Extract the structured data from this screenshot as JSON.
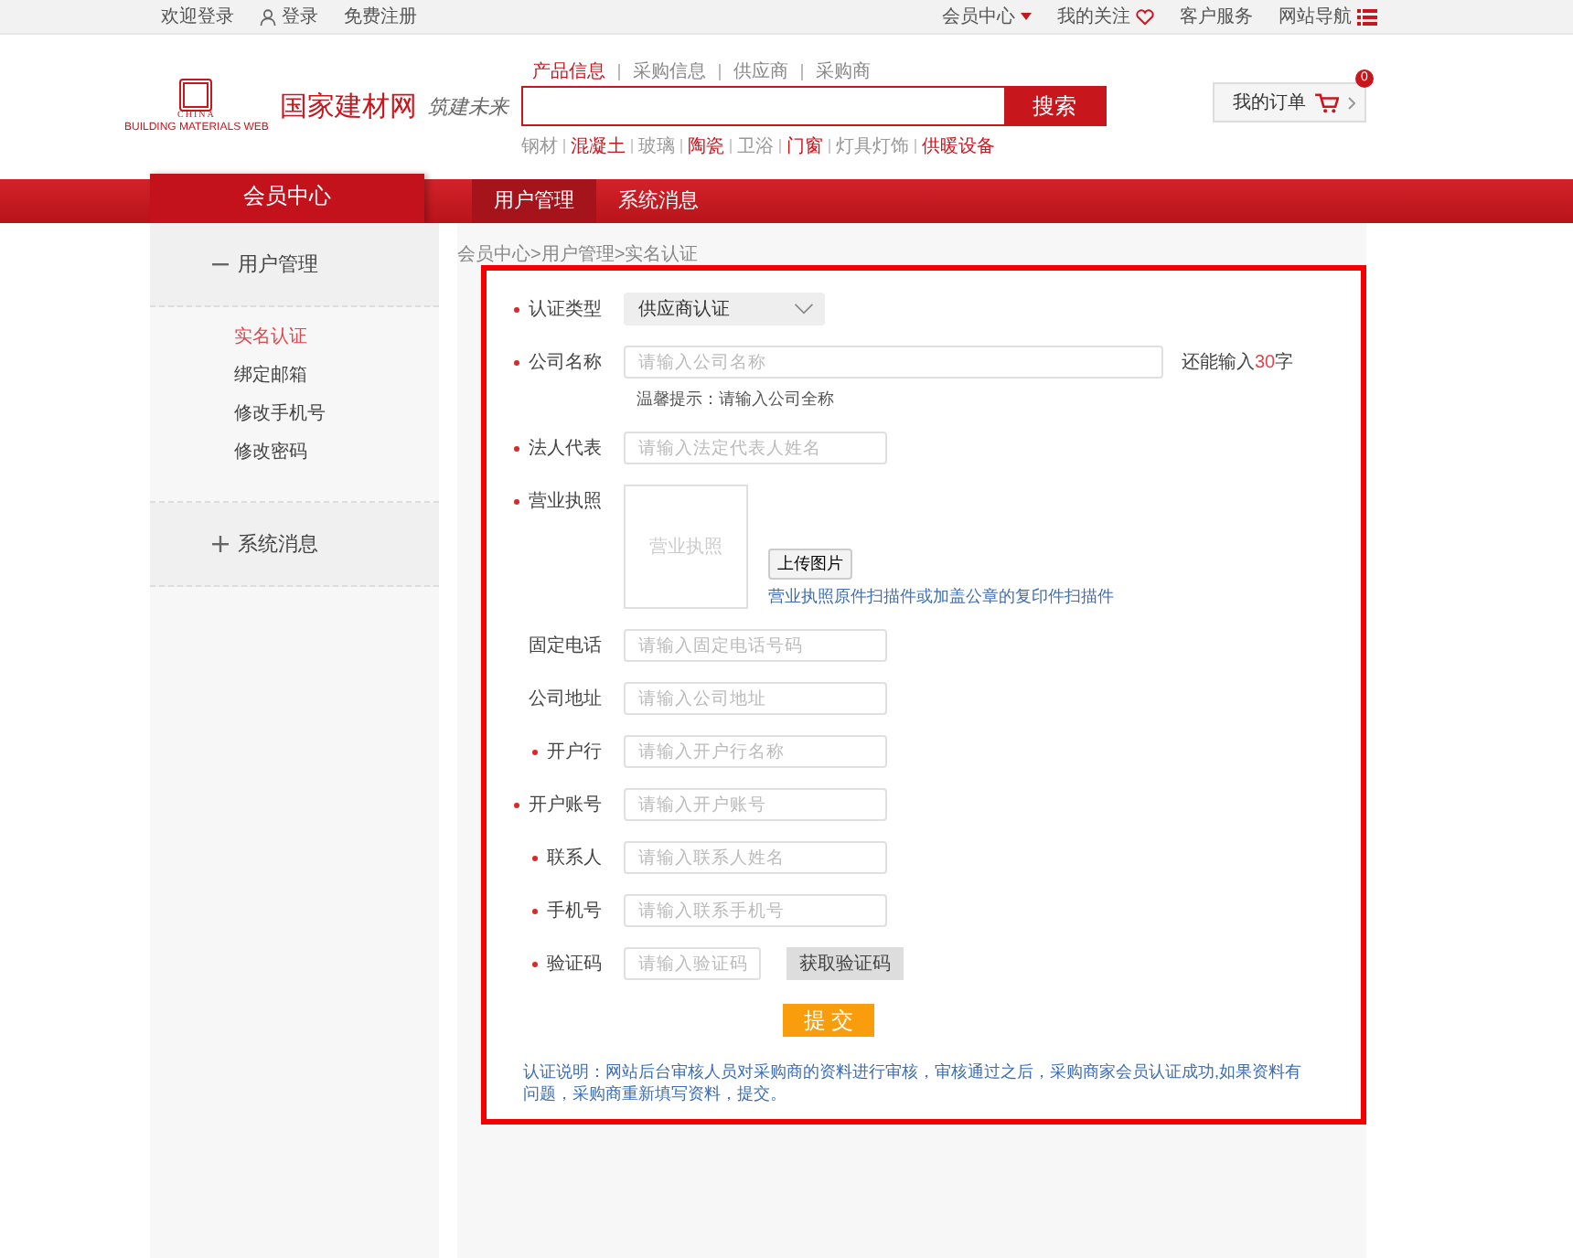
{
  "top_bar": {
    "left": [
      {
        "kind": "text",
        "label": "欢迎登录"
      },
      {
        "kind": "user",
        "label": "登录"
      },
      {
        "kind": "text",
        "label": "免费注册"
      }
    ],
    "right": [
      {
        "kind": "dropdown",
        "label": "会员中心"
      },
      {
        "kind": "heart",
        "label": "我的关注"
      },
      {
        "kind": "text",
        "label": "客户服务"
      },
      {
        "kind": "list",
        "label": "网站导航"
      }
    ]
  },
  "header": {
    "logo_sub": "CHINA",
    "logo_small": "BUILDING MATERIALS WEB",
    "site_name": "国家建材网",
    "slogan": "筑建未来",
    "search_tabs": [
      {
        "label": "产品信息",
        "selected": true
      },
      {
        "label": "采购信息",
        "selected": false
      },
      {
        "label": "供应商",
        "selected": false
      },
      {
        "label": "采购商",
        "selected": false
      }
    ],
    "search_button": "搜索",
    "hot_words": [
      {
        "label": "钢材",
        "highlight": false
      },
      {
        "label": "混凝土",
        "highlight": true
      },
      {
        "label": "玻璃",
        "highlight": false
      },
      {
        "label": "陶瓷",
        "highlight": true
      },
      {
        "label": "卫浴",
        "highlight": false
      },
      {
        "label": "门窗",
        "highlight": true
      },
      {
        "label": "灯具灯饰",
        "highlight": false
      },
      {
        "label": "供暖设备",
        "highlight": true
      }
    ],
    "orders_button": "我的订单",
    "cart_count": "0"
  },
  "nav": {
    "home": "会员中心",
    "tabs": [
      {
        "label": "用户管理",
        "selected": true
      },
      {
        "label": "系统消息",
        "selected": false
      }
    ]
  },
  "sidebar": {
    "groups": [
      {
        "title": "用户管理",
        "expanded": true,
        "items": [
          {
            "label": "实名认证",
            "selected": true
          },
          {
            "label": "绑定邮箱",
            "selected": false
          },
          {
            "label": "修改手机号",
            "selected": false
          },
          {
            "label": "修改密码",
            "selected": false
          }
        ]
      },
      {
        "title": "系统消息",
        "expanded": false
      }
    ]
  },
  "breadcrumb": "会员中心>用户管理>实名认证",
  "form": {
    "highlighted": true,
    "fields": [
      {
        "kind": "select",
        "label": "认证类型",
        "required": true,
        "value": "供应商认证"
      },
      {
        "kind": "counted",
        "label": "公司名称",
        "required": true,
        "placeholder": "请输入公司名称",
        "counter_prefix": "还能输入",
        "counter_value": "30",
        "counter_suffix": "字",
        "hint": "温馨提示：请输入公司全称"
      },
      {
        "kind": "text",
        "label": "法人代表",
        "required": true,
        "placeholder": "请输入法定代表人姓名"
      },
      {
        "kind": "upload",
        "label": "营业执照",
        "required": true,
        "placeholder": "营业执照",
        "button": "上传图片",
        "link": "营业执照原件扫描件或加盖公章的复印件扫描件"
      },
      {
        "kind": "text",
        "label": "固定电话",
        "required": false,
        "placeholder": "请输入固定电话号码"
      },
      {
        "kind": "text",
        "label": "公司地址",
        "required": false,
        "placeholder": "请输入公司地址"
      },
      {
        "kind": "text",
        "label": "开户行",
        "required": true,
        "placeholder": "请输入开户行名称"
      },
      {
        "kind": "text",
        "label": "开户账号",
        "required": true,
        "placeholder": "请输入开户账号"
      },
      {
        "kind": "text",
        "label": "联系人",
        "required": true,
        "placeholder": "请输入联系人姓名"
      },
      {
        "kind": "text",
        "label": "手机号",
        "required": true,
        "placeholder": "请输入联系手机号"
      },
      {
        "kind": "code",
        "label": "验证码",
        "required": true,
        "placeholder": "请输入验证码",
        "button": "获取验证码"
      }
    ],
    "submit": "提 交",
    "note": "认证说明：网站后台审核人员对采购商的资料进行审核，审核通过之后，采购商家会员认证成功,如果资料有问题，采购商重新填写资料，提交。"
  }
}
